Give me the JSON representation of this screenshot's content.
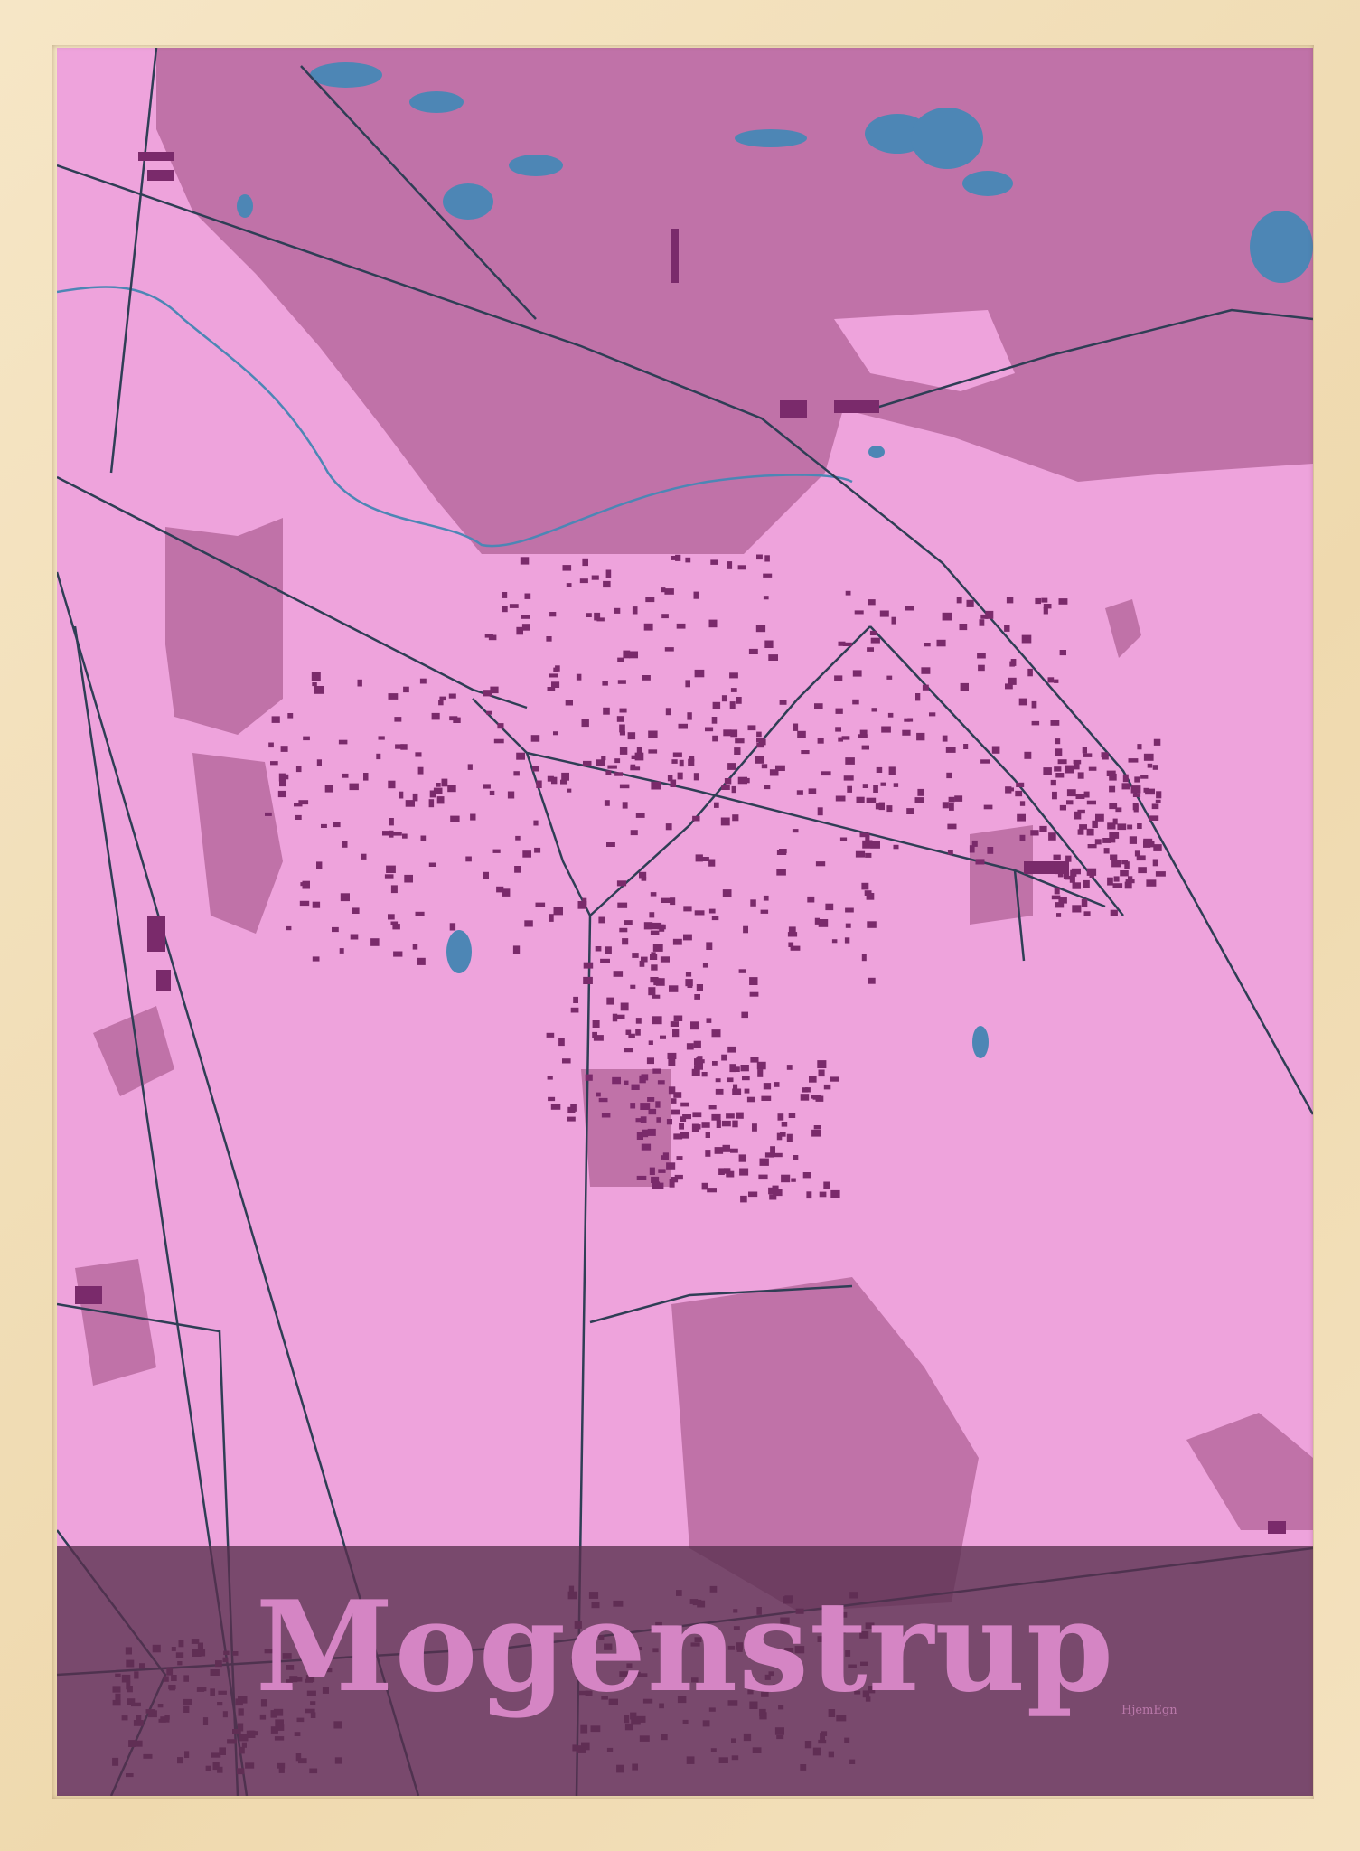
{
  "poster": {
    "town_name": "Mogenstrup",
    "brand": "HjemEgn"
  },
  "colors": {
    "frame": "#f0dcb4",
    "land": "#eea3dc",
    "forest": "#c072a8",
    "water": "#4d86b5",
    "roads": "#2f3e55",
    "buildings": "#7a2a6b",
    "title_band": "#58304e",
    "title_text": "#d585c4"
  }
}
